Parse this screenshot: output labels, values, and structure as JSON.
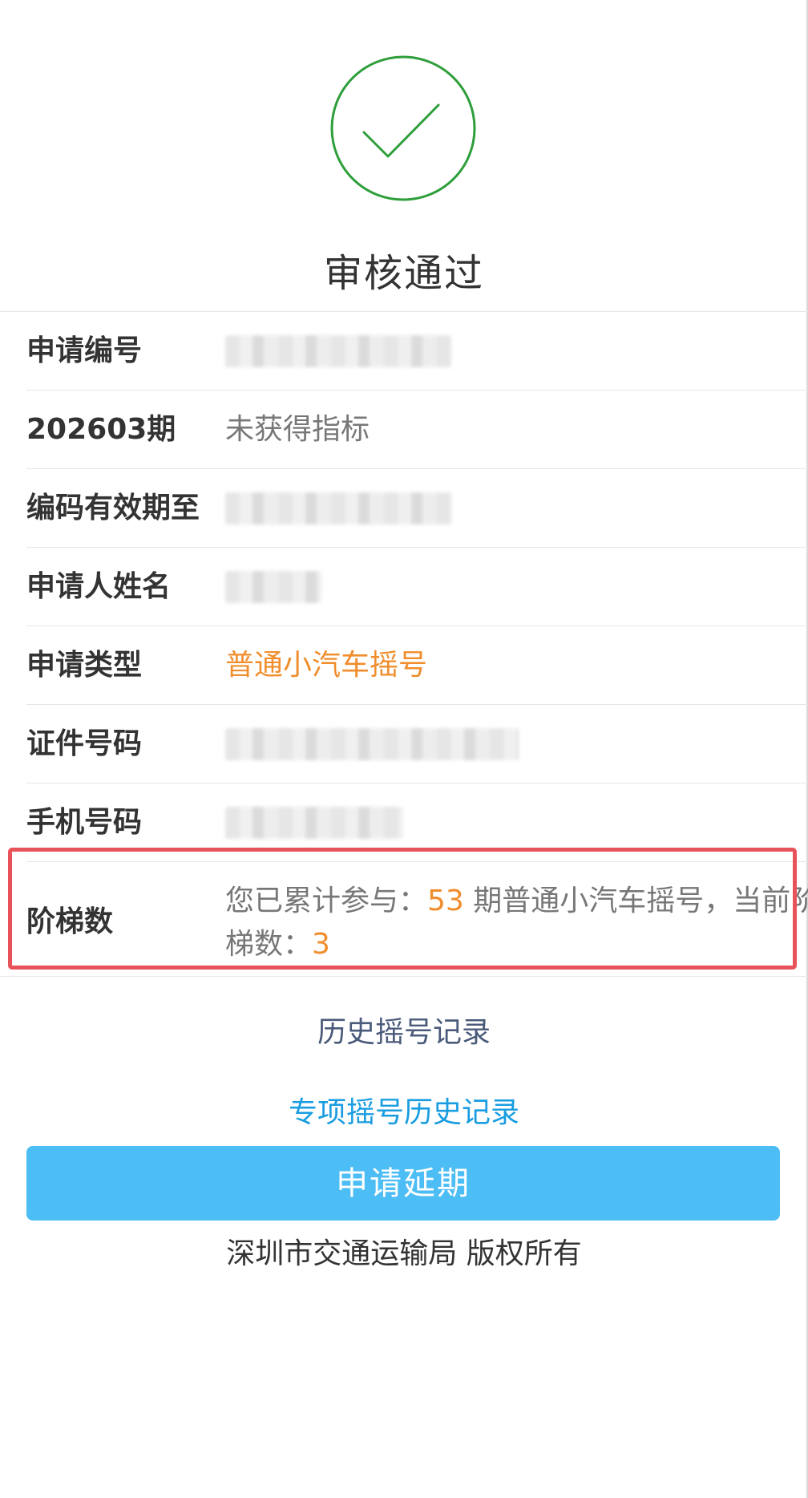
{
  "status": {
    "icon": "check-circle-icon",
    "title": "审核通过",
    "icon_color": "#2e9e3a"
  },
  "info_rows": [
    {
      "label": "申请编号",
      "value": "",
      "obscured": true
    },
    {
      "label": "202603期",
      "value": "未获得指标"
    },
    {
      "label": "编码有效期至",
      "value": "",
      "obscured": true
    },
    {
      "label": "申请人姓名",
      "value": "",
      "obscured": true
    },
    {
      "label": "申请类型",
      "value": "普通小汽车摇号"
    },
    {
      "label": "证件号码",
      "value": "",
      "obscured": true
    },
    {
      "label": "手机号码",
      "value": "",
      "obscured": true
    }
  ],
  "ladder": {
    "label": "阶梯数",
    "text_prefix": "您已累计参与：",
    "periods": "53",
    "text_middle": " 期普通小汽车摇号，当前阶梯数：",
    "ladder_count": "3"
  },
  "links": {
    "history": "历史摇号记录",
    "special_history": "专项摇号历史记录"
  },
  "apply_button": "申请延期",
  "footer": "深圳市交通运输局 版权所有",
  "colors": {
    "accent_orange": "#f08d2c",
    "button_blue": "#4dbdf6",
    "link_blue": "#1a9de0",
    "highlight_red": "#e8535b"
  }
}
